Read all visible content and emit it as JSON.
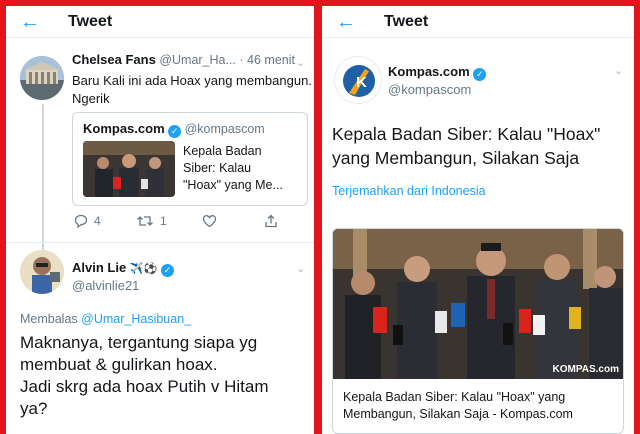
{
  "left": {
    "header": {
      "title": "Tweet"
    },
    "tweet1": {
      "name": "Chelsea Fans",
      "handle": "@Umar_Ha...",
      "dot": "·",
      "time": "46 menit",
      "text_line1": "Baru Kali ini ada Hoax yang membangun.",
      "text_line2": "Ngerik",
      "quote": {
        "name": "Kompas.com",
        "handle": "@kompascom",
        "text_line1": "Kepala Badan",
        "text_line2": "Siber: Kalau",
        "text_line3": "\"Hoax\" yang Me..."
      },
      "reply_count": "4",
      "retweet_count": "1"
    },
    "tweet2": {
      "name": "Alvin Lie",
      "name_emoji": "✈️⚽",
      "handle": "@alvinlie21",
      "replying_prefix": "Membalas",
      "replying_handle": "@Umar_Hasibuan_",
      "text_line1": "Maknanya, tergantung siapa yg",
      "text_line2": "membuat & gulirkan hoax.",
      "text_line3": "Jadi skrg ada hoax Putih v Hitam",
      "text_line4": "ya?"
    }
  },
  "right": {
    "header": {
      "title": "Tweet"
    },
    "tweet": {
      "name": "Kompas.com",
      "handle": "@kompascom",
      "text_line1": "Kepala Badan Siber: Kalau \"Hoax\"",
      "text_line2": "yang Membangun, Silakan Saja",
      "translate": "Terjemahkan dari Indonesia",
      "card_title_line1": "Kepala Badan Siber: Kalau \"Hoax\" yang",
      "card_title_line2": "Membangun, Silakan Saja - Kompas.com",
      "watermark": "KOMPAS.com"
    }
  },
  "colors": {
    "accent": "#1da1f2",
    "frame": "#e1151b",
    "muted": "#657786"
  },
  "icons": [
    "back-arrow-icon",
    "reply-icon",
    "retweet-icon",
    "like-icon",
    "share-icon",
    "verified-icon",
    "chevron-down-icon"
  ]
}
